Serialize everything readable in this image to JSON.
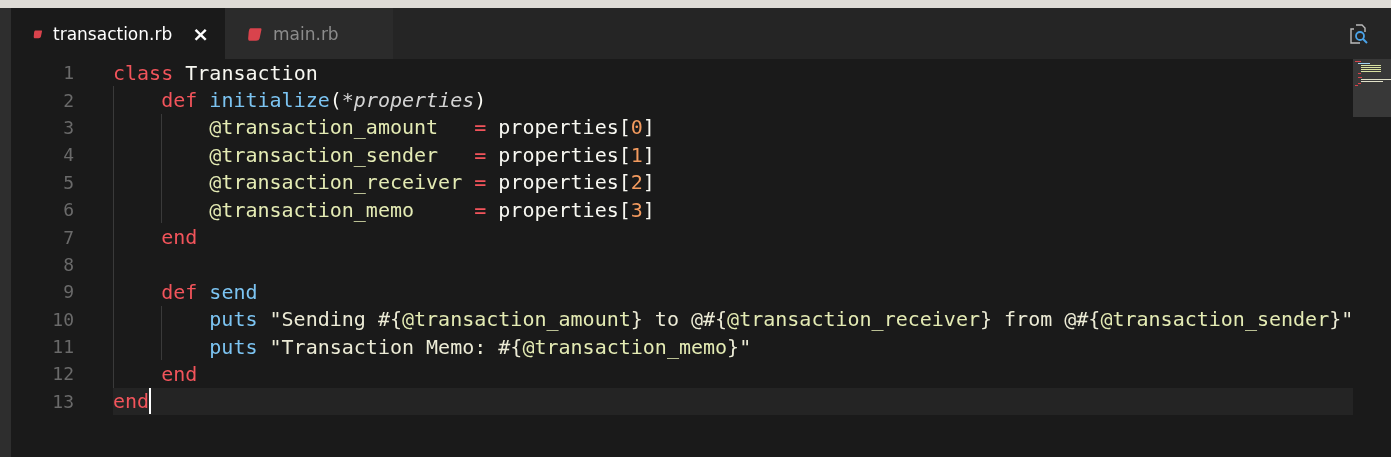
{
  "tabs": [
    {
      "label": "transaction.rb",
      "selected": true,
      "close": "×"
    },
    {
      "label": "main.rb",
      "selected": false
    }
  ],
  "editor": {
    "lines": [
      {
        "number": "1",
        "current": false,
        "tokens": [
          {
            "kind": "keyword",
            "text": "class"
          },
          {
            "kind": "plain",
            "text": " Transaction"
          }
        ]
      },
      {
        "number": "2",
        "current": false,
        "tokens": [
          {
            "kind": "keyword",
            "text": "    def"
          },
          {
            "kind": "function",
            "text": " initialize"
          },
          {
            "kind": "plain",
            "text": "("
          },
          {
            "kind": "param",
            "text": "*properties"
          },
          {
            "kind": "plain",
            "text": ")"
          }
        ]
      },
      {
        "number": "3",
        "current": false,
        "tokens": [
          {
            "kind": "ivar",
            "text": "        @transaction_amount"
          },
          {
            "kind": "operator",
            "text": "   ="
          },
          {
            "kind": "plain",
            "text": " properties["
          },
          {
            "kind": "number",
            "text": "0"
          },
          {
            "kind": "plain",
            "text": "]"
          }
        ]
      },
      {
        "number": "4",
        "current": false,
        "tokens": [
          {
            "kind": "ivar",
            "text": "        @transaction_sender"
          },
          {
            "kind": "operator",
            "text": "   ="
          },
          {
            "kind": "plain",
            "text": " properties["
          },
          {
            "kind": "number",
            "text": "1"
          },
          {
            "kind": "plain",
            "text": "]"
          }
        ]
      },
      {
        "number": "5",
        "current": false,
        "tokens": [
          {
            "kind": "ivar",
            "text": "        @transaction_receiver"
          },
          {
            "kind": "operator",
            "text": " ="
          },
          {
            "kind": "plain",
            "text": " properties["
          },
          {
            "kind": "number",
            "text": "2"
          },
          {
            "kind": "plain",
            "text": "]"
          }
        ]
      },
      {
        "number": "6",
        "current": false,
        "tokens": [
          {
            "kind": "ivar",
            "text": "        @transaction_memo"
          },
          {
            "kind": "operator",
            "text": "     ="
          },
          {
            "kind": "plain",
            "text": " properties["
          },
          {
            "kind": "number",
            "text": "3"
          },
          {
            "kind": "plain",
            "text": "]"
          }
        ]
      },
      {
        "number": "7",
        "current": false,
        "tokens": [
          {
            "kind": "keyword",
            "text": "    end"
          }
        ]
      },
      {
        "number": "8",
        "current": false
      },
      {
        "number": "9",
        "current": false,
        "tokens": [
          {
            "kind": "keyword",
            "text": "    def"
          },
          {
            "kind": "function",
            "text": " send"
          }
        ]
      },
      {
        "number": "10",
        "current": false,
        "tokens": [
          {
            "kind": "function",
            "text": "        puts"
          },
          {
            "kind": "string",
            "text": " \"Sending #{"
          },
          {
            "kind": "ivar",
            "text": "@transaction_amount"
          },
          {
            "kind": "string",
            "text": "} to @#{"
          },
          {
            "kind": "ivar",
            "text": "@transaction_receiver"
          },
          {
            "kind": "string",
            "text": "} from @#{"
          },
          {
            "kind": "ivar",
            "text": "@transaction_sender"
          },
          {
            "kind": "string",
            "text": "}\""
          }
        ]
      },
      {
        "number": "11",
        "current": false,
        "tokens": [
          {
            "kind": "function",
            "text": "        puts"
          },
          {
            "kind": "string",
            "text": " \"Transaction Memo: #{"
          },
          {
            "kind": "ivar",
            "text": "@transaction_memo"
          },
          {
            "kind": "string",
            "text": "}\""
          }
        ]
      },
      {
        "number": "12",
        "current": false,
        "tokens": [
          {
            "kind": "keyword",
            "text": "    end"
          }
        ]
      },
      {
        "number": "13",
        "current": true,
        "tokens": [
          {
            "kind": "keyword",
            "text": "end"
          }
        ]
      }
    ]
  }
}
